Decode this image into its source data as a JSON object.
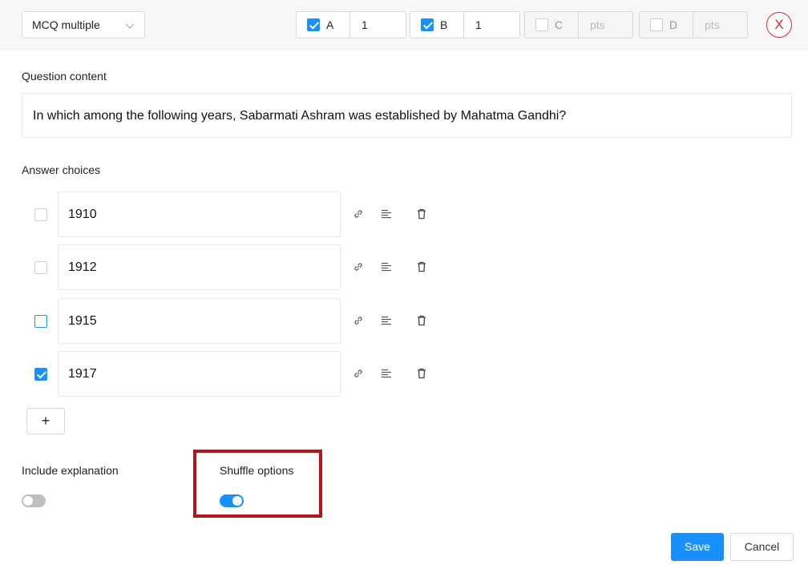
{
  "question_type": {
    "selected": "MCQ multiple"
  },
  "options_bar": [
    {
      "letter": "A",
      "checked": true,
      "points": "1",
      "points_placeholder": "pts"
    },
    {
      "letter": "B",
      "checked": true,
      "points": "1",
      "points_placeholder": "pts"
    },
    {
      "letter": "C",
      "checked": false,
      "points": "",
      "points_placeholder": "pts"
    },
    {
      "letter": "D",
      "checked": false,
      "points": "",
      "points_placeholder": "pts"
    }
  ],
  "close_label": "X",
  "question": {
    "label": "Question content",
    "text": "In which among the following years, Sabarmati Ashram was established by Mahatma Gandhi?"
  },
  "answers": {
    "label": "Answer choices",
    "items": [
      {
        "text": "1910",
        "checked": false
      },
      {
        "text": "1912",
        "checked": false
      },
      {
        "text": "1915",
        "checked": false
      },
      {
        "text": "1917",
        "checked": true
      }
    ],
    "add_label": "+"
  },
  "include_explanation": {
    "label": "Include explanation",
    "enabled": false
  },
  "shuffle_options": {
    "label": "Shuffle options",
    "enabled": true
  },
  "footer": {
    "save_label": "Save",
    "cancel_label": "Cancel"
  },
  "colors": {
    "accent": "#1890ff",
    "danger": "#e0282e",
    "highlight": "#b3151b"
  },
  "icons": {
    "link": "link-icon",
    "align": "align-left-icon",
    "delete": "trash-icon"
  }
}
